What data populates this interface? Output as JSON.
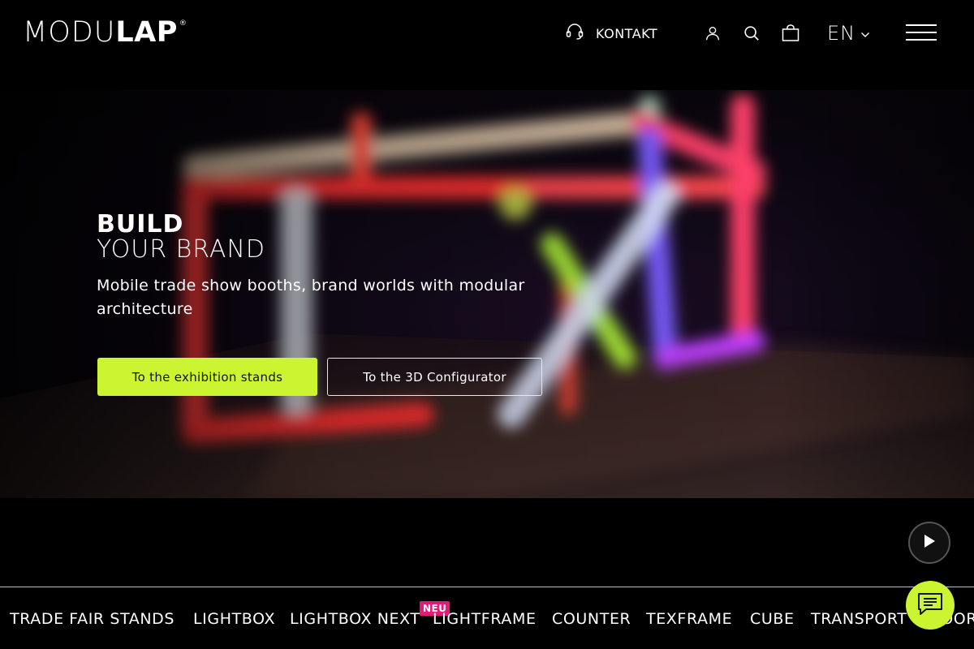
{
  "header": {
    "logo": {
      "light": "MODU",
      "bold": "LAP",
      "registered": "®"
    },
    "contact_label": "KONTAKT",
    "language": "EN",
    "icons": [
      "headset-icon",
      "user-icon",
      "search-icon",
      "cart-icon",
      "chevron-down-icon",
      "hamburger-menu-icon"
    ]
  },
  "hero": {
    "title_bold": "BUILD",
    "title_light": "YOUR BRAND",
    "subtitle": "Mobile trade show booths, brand worlds with modular architecture",
    "primary_button": "To the exhibition stands",
    "secondary_button": "To the 3D Configurator"
  },
  "nav": {
    "items": [
      "TRADE FAIR STANDS",
      "LIGHTBOX",
      "LIGHTBOX NEXT",
      "LIGHTFRAME",
      "COUNTER",
      "TEXFRAME",
      "CUBE",
      "TRANSPORT",
      "DOOR"
    ],
    "badge": "NEU"
  },
  "colors": {
    "accent": "#ccf531",
    "badge": "#e5197a",
    "background": "#000000"
  }
}
